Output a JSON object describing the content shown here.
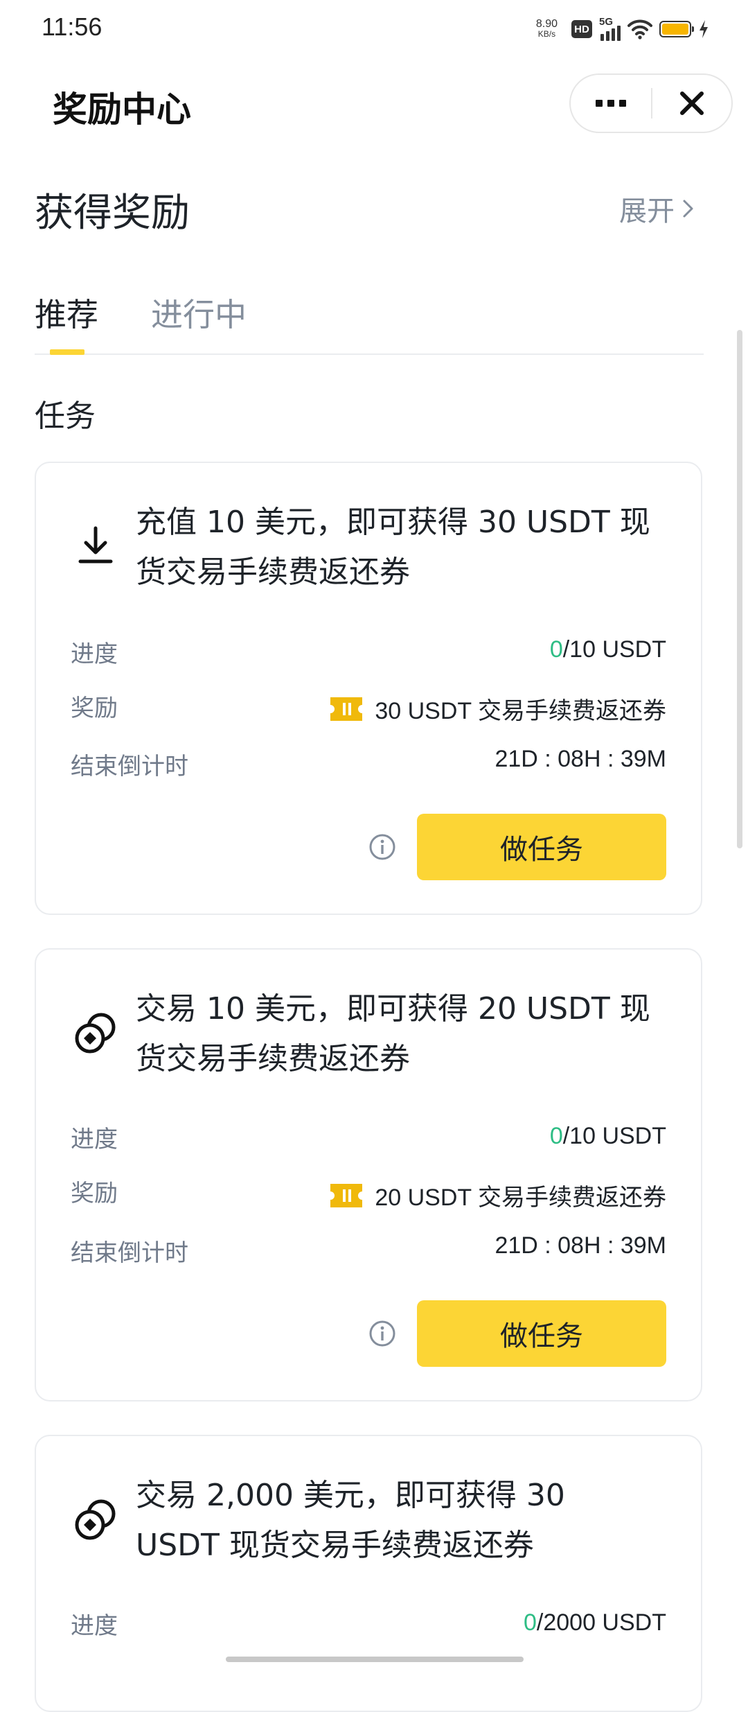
{
  "status_bar": {
    "time": "11:56",
    "speed_value": "8.90",
    "speed_unit": "KB/s",
    "hd_label": "HD",
    "network_label": "5G",
    "battery_color": "#f7b500"
  },
  "header": {
    "title": "奖励中心",
    "more_icon": "ellipsis-icon",
    "close_icon": "close-icon"
  },
  "rewards_section": {
    "title": "获得奖励",
    "expand_label": "展开",
    "expand_icon": "chevron-right-icon"
  },
  "tabs": [
    {
      "label": "推荐",
      "active": true
    },
    {
      "label": "进行中",
      "active": false
    }
  ],
  "tasks_section": {
    "title": "任务"
  },
  "accent_color": "#fcd535",
  "progress_color": "#2ebd85",
  "tasks": [
    {
      "icon": "download-icon",
      "title": "充值 10 美元，即可获得 30 USDT 现货交易手续费返还券",
      "progress_label": "进度",
      "progress_current": "0",
      "progress_target": "/10 USDT",
      "reward_label": "奖励",
      "reward_icon": "ticket-icon",
      "reward_value": "30 USDT 交易手续费返还券",
      "countdown_label": "结束倒计时",
      "countdown_value": "21D : 08H : 39M",
      "info_icon": "info-icon",
      "button_label": "做任务"
    },
    {
      "icon": "trade-coins-icon",
      "title": "交易 10 美元，即可获得 20 USDT 现货交易手续费返还券",
      "progress_label": "进度",
      "progress_current": "0",
      "progress_target": "/10 USDT",
      "reward_label": "奖励",
      "reward_icon": "ticket-icon",
      "reward_value": "20 USDT 交易手续费返还券",
      "countdown_label": "结束倒计时",
      "countdown_value": "21D : 08H : 39M",
      "info_icon": "info-icon",
      "button_label": "做任务"
    },
    {
      "icon": "trade-coins-icon",
      "title": "交易 2,000 美元，即可获得 30 USDT 现货交易手续费返还券",
      "progress_label": "进度",
      "progress_current": "0",
      "progress_target": "/2000 USDT"
    }
  ]
}
